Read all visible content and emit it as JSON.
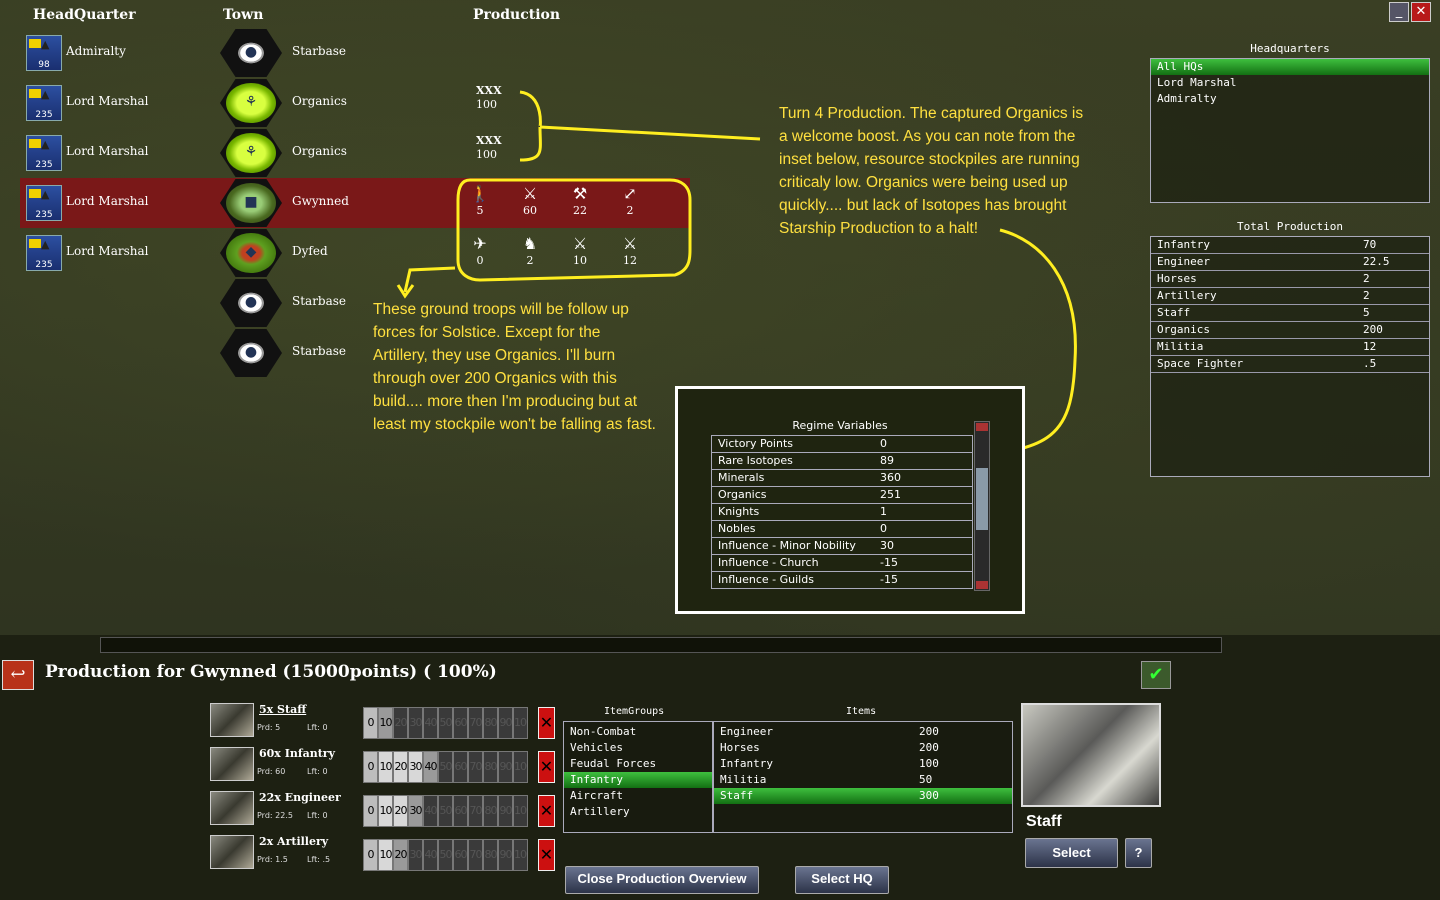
{
  "headers": {
    "hq": "HeadQuarter",
    "town": "Town",
    "production": "Production"
  },
  "rows": [
    {
      "hq": "Admiralty",
      "hq_num": "98",
      "town": "Starbase",
      "type": "star"
    },
    {
      "hq": "Lord Marshal",
      "hq_num": "235",
      "town": "Organics",
      "type": "org",
      "prod_label": "XXX",
      "prod_value": "100"
    },
    {
      "hq": "Lord Marshal",
      "hq_num": "235",
      "town": "Organics",
      "type": "org",
      "prod_label": "XXX",
      "prod_value": "100"
    },
    {
      "hq": "Lord Marshal",
      "hq_num": "235",
      "town": "Gwynned",
      "type": "city"
    },
    {
      "hq": "Lord Marshal",
      "hq_num": "235",
      "town": "Dyfed",
      "type": "dye"
    },
    {
      "town": "Starbase",
      "type": "star"
    },
    {
      "town": "Starbase",
      "type": "star"
    }
  ],
  "units_row1": [
    {
      "icon": "infantry-icon",
      "glyph": "🚶",
      "value": "5"
    },
    {
      "icon": "rifleman-icon",
      "glyph": "⚔",
      "value": "60"
    },
    {
      "icon": "engineer-icon",
      "glyph": "⚒",
      "value": "22"
    },
    {
      "icon": "artillery-icon",
      "glyph": "⤢",
      "value": "2"
    }
  ],
  "units_row2": [
    {
      "icon": "fighter-icon",
      "glyph": "✈",
      "value": "0"
    },
    {
      "icon": "horse-icon",
      "glyph": "♞",
      "value": "2"
    },
    {
      "icon": "militia-icon",
      "glyph": "⚔",
      "value": "10"
    },
    {
      "icon": "soldier-icon",
      "glyph": "⚔",
      "value": "12"
    }
  ],
  "notes": {
    "turn": "Turn 4 Production. The captured Organics is a welcome boost. As you can note from the inset below, resource stockpiles are running criticaly low.  Organics were being used up quickly.... but lack of Isotopes has brought Starship Production to a halt!",
    "troops": "These ground troops will be follow up forces for Solstice. Except for the Artillery, they use Organics. I'll burn through over 200 Organics with this build.... more then I'm producing but at least my stockpile won't be falling as fast."
  },
  "headquarters": {
    "title": "Headquarters",
    "items": [
      "All HQs",
      "Lord Marshal",
      "Admiralty"
    ],
    "selected": 0
  },
  "total_production": {
    "title": "Total Production",
    "rows": [
      {
        "name": "Infantry",
        "value": "70"
      },
      {
        "name": "Engineer",
        "value": "22.5"
      },
      {
        "name": "Horses",
        "value": "2"
      },
      {
        "name": "Artillery",
        "value": "2"
      },
      {
        "name": "Staff",
        "value": "5"
      },
      {
        "name": "Organics",
        "value": "200"
      },
      {
        "name": "Militia",
        "value": "12"
      },
      {
        "name": "Space Fighter",
        "value": ".5"
      }
    ]
  },
  "regime": {
    "title": "Regime Variables",
    "rows": [
      {
        "name": "Victory Points",
        "value": "0"
      },
      {
        "name": "Rare Isotopes",
        "value": "89"
      },
      {
        "name": "Minerals",
        "value": "360"
      },
      {
        "name": "Organics",
        "value": "251"
      },
      {
        "name": "Knights",
        "value": "1"
      },
      {
        "name": "Nobles",
        "value": "0"
      },
      {
        "name": "Influence - Minor Nobility",
        "value": "30"
      },
      {
        "name": "Influence - Church",
        "value": "-15"
      },
      {
        "name": "Influence - Guilds",
        "value": "-15"
      }
    ]
  },
  "production_title": "Production for Gwynned (15000points) ( 100%)",
  "queue": [
    {
      "name": "5x Staff",
      "prd": "Prd: 5",
      "lft": "Lft: 0",
      "level": 1,
      "underline": true
    },
    {
      "name": "60x Infantry",
      "prd": "Prd: 60",
      "lft": "Lft: 0",
      "level": 4
    },
    {
      "name": "22x Engineer",
      "prd": "Prd: 22.5",
      "lft": "Lft: 0",
      "level": 3
    },
    {
      "name": "2x Artillery",
      "prd": "Prd: 1.5",
      "lft": "Lft: .5",
      "level": 2
    }
  ],
  "slider_labels": [
    "0",
    "10",
    "20",
    "30",
    "40",
    "50",
    "60",
    "70",
    "80",
    "90",
    "100"
  ],
  "item_groups": {
    "title": "ItemGroups",
    "items": [
      "Non-Combat",
      "Vehicles",
      "Feudal Forces",
      "Infantry",
      "Aircraft",
      "Artillery"
    ],
    "selected": 3
  },
  "items": {
    "title": "Items",
    "rows": [
      {
        "name": "Engineer",
        "value": "200"
      },
      {
        "name": "Horses",
        "value": "200"
      },
      {
        "name": "Infantry",
        "value": "100"
      },
      {
        "name": "Militia",
        "value": "50"
      },
      {
        "name": "Staff",
        "value": "300"
      }
    ],
    "selected": 4
  },
  "selected_item": {
    "name": "Staff"
  },
  "buttons": {
    "select": "Select",
    "help": "?",
    "close_overview": "Close Production Overview",
    "select_hq": "Select HQ"
  }
}
